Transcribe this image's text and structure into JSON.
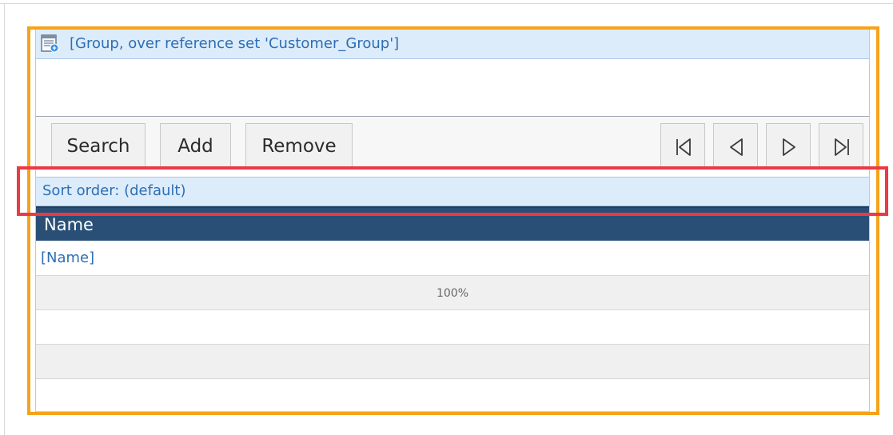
{
  "group": {
    "title": "[Group, over reference set 'Customer_Group']",
    "icon": "list-group-icon"
  },
  "toolbar": {
    "search_label": "Search",
    "add_label": "Add",
    "remove_label": "Remove",
    "nav_icons": [
      "first-page-icon",
      "previous-page-icon",
      "next-page-icon",
      "last-page-icon"
    ]
  },
  "sort": {
    "label": "Sort order: (default)"
  },
  "table": {
    "header": "Name",
    "row_value": "[Name]",
    "progress_label": "100%"
  },
  "colors": {
    "header_blue": "#294f76",
    "accent_blue": "#2f6eb3",
    "highlight_orange": "#f5a31a",
    "highlight_red": "#ea3b45",
    "light_blue": "#dcecfb"
  }
}
